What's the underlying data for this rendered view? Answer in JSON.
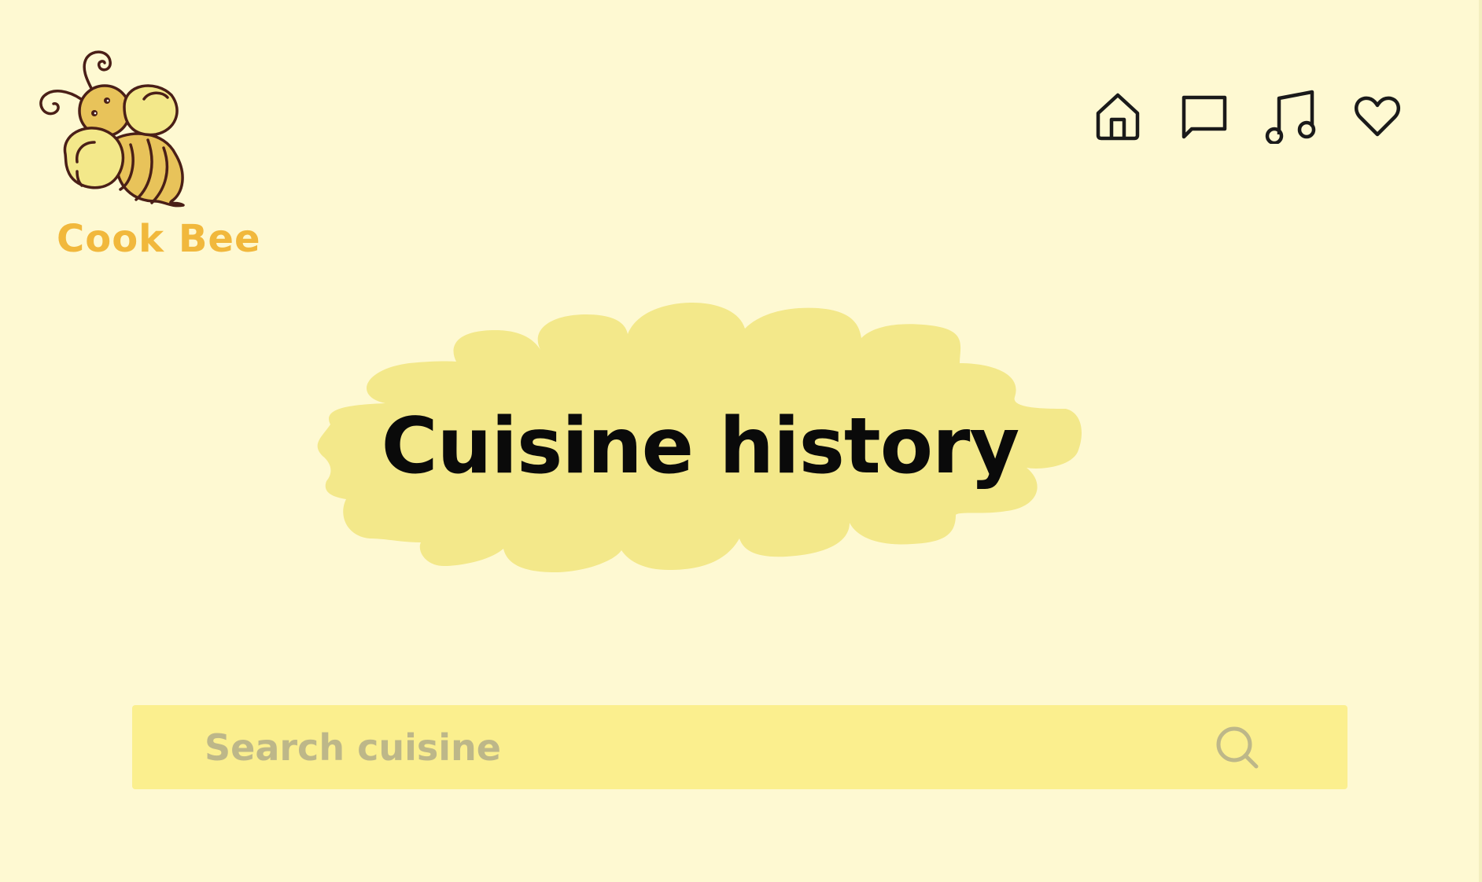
{
  "brand": {
    "name": "Cook Bee",
    "name_color": "#f1b83c",
    "logo_icon": "bee-icon"
  },
  "nav": {
    "items": [
      {
        "icon": "home-icon"
      },
      {
        "icon": "chat-icon"
      },
      {
        "icon": "music-note-icon"
      },
      {
        "icon": "heart-icon"
      }
    ],
    "icon_color": "#1a1a1a"
  },
  "hero": {
    "title": "Cuisine history",
    "cloud_color": "#f3e88a"
  },
  "search": {
    "placeholder": "Search cuisine",
    "value": "",
    "bar_color": "#fbef8e",
    "icon": "search-icon",
    "icon_color": "#bdb789"
  },
  "colors": {
    "background": "#fef9d2"
  }
}
